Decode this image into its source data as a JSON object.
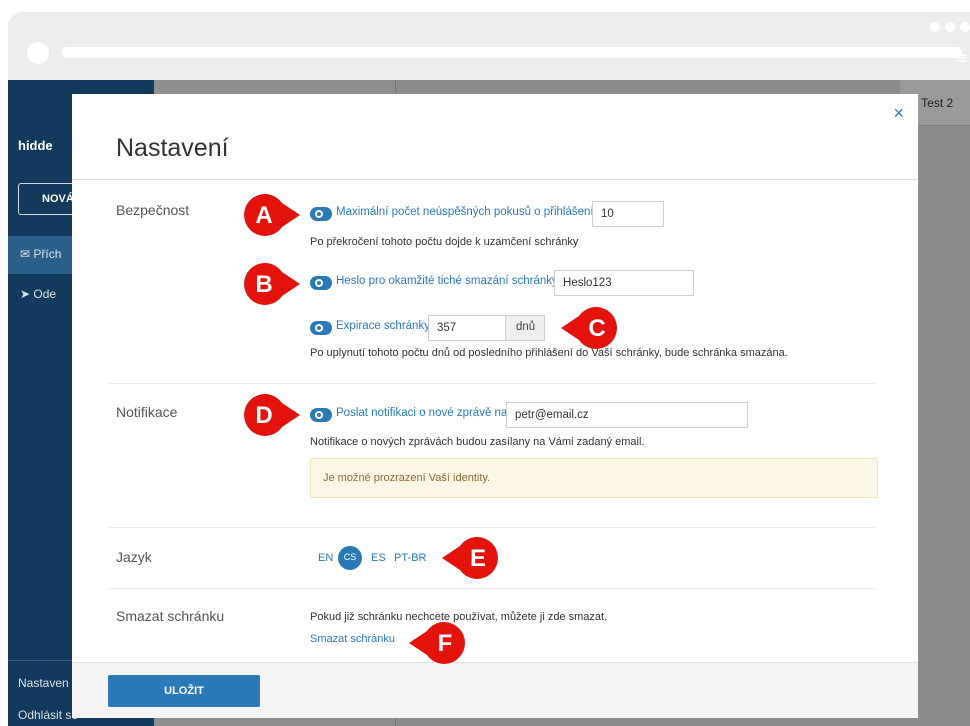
{
  "browser": {
    "menu_icon": "hamburger-icon"
  },
  "app": {
    "brand": "hidde",
    "new_button": "NOVÁ",
    "nav": [
      {
        "label": "Přích",
        "icon": "inbox-icon"
      },
      {
        "label": "Ode",
        "icon": "send-icon"
      }
    ],
    "bottom": [
      "Nastaven",
      "Odhlásit se"
    ],
    "user": "Test 2"
  },
  "modal": {
    "title": "Nastavení",
    "close": "×",
    "sections": {
      "security": {
        "label": "Bezpečnost",
        "max_attempts_label": "Maximální počet neúspěšných pokusů o přihlášení:",
        "max_attempts_value": "10",
        "max_attempts_help": "Po překročení tohoto počtu dojde k uzamčení schránky",
        "wipe_password_label": "Heslo pro okamžité tiché smazání schránky:",
        "wipe_password_value": "Heslo123",
        "expiration_label": "Expirace schránky:",
        "expiration_value": "357",
        "expiration_unit": "dnů",
        "expiration_help": "Po uplynutí tohoto počtu dnů od posledního přihlášení do Vaší schránky, bude schránka smazána."
      },
      "notifications": {
        "label": "Notifikace",
        "notify_label": "Poslat notifikaci o nové zprávě na:",
        "notify_value": "petr@email.cz",
        "notify_help": "Notifikace o nových zprávách budou zasílany na Vámi zadaný email.",
        "warning": "Je možné prozrazení Vaší identity."
      },
      "language": {
        "label": "Jazyk",
        "options": [
          "EN",
          "CS",
          "ES",
          "PT-BR"
        ],
        "selected": "CS"
      },
      "delete": {
        "label": "Smazat schránku",
        "help": "Pokud již schránku nechcete používat, můžete ji zde smazat.",
        "link": "Smazat schránku"
      }
    },
    "save_button": "ULOŽIT"
  },
  "badges": [
    "A",
    "B",
    "C",
    "D",
    "E",
    "F"
  ],
  "colors": {
    "accent": "#2a7ab8",
    "badge": "#e3120b",
    "sidebar": "#123a5c"
  }
}
